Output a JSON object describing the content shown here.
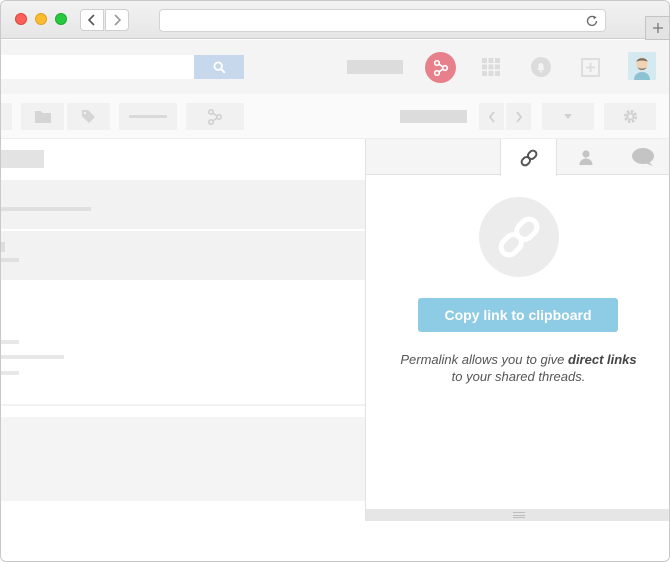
{
  "browser": {
    "url": "",
    "icons": [
      "back-icon",
      "forward-icon",
      "reload-icon",
      "new-tab-icon"
    ]
  },
  "header": {
    "icons": [
      "search-icon",
      "share-icon",
      "apps-grid-icon",
      "notification-bell-icon",
      "add-icon",
      "avatar"
    ]
  },
  "toolbar": {
    "icons": [
      "folder-icon",
      "tag-icon",
      "share-icon",
      "prev-icon",
      "next-icon",
      "dropdown-icon",
      "gear-icon"
    ]
  },
  "panel": {
    "tabs": [
      {
        "name": "permalink",
        "icon": "link-icon",
        "active": true
      },
      {
        "name": "people",
        "icon": "user-icon",
        "active": false
      },
      {
        "name": "comments",
        "icon": "comment-icon",
        "active": false
      }
    ],
    "copy_button_label": "Copy link to clipboard",
    "description": {
      "part1": "Permalink allows you to give ",
      "bold": "direct links",
      "part2": " to your shared threads."
    }
  },
  "colors": {
    "accent": "#8ecbe4",
    "share_badge": "#e8808c"
  }
}
